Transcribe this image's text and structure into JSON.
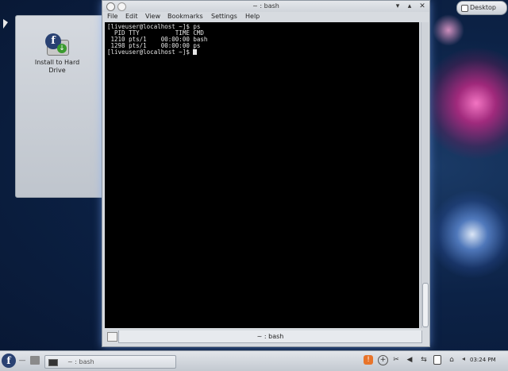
{
  "desktop": {
    "toolbox_label": "Desktop",
    "icons": [
      {
        "label_line1": "Install to Hard",
        "label_line2": "Drive",
        "icon": "fedora-install-icon"
      }
    ]
  },
  "window": {
    "title": "~ : bash",
    "menu": [
      "File",
      "Edit",
      "View",
      "Bookmarks",
      "Settings",
      "Help"
    ],
    "terminal_lines": [
      "[liveuser@localhost ~]$ ps",
      "  PID TTY          TIME CMD",
      " 1210 pts/1    00:00:00 bash",
      " 1298 pts/1    00:00:00 ps",
      "[liveuser@localhost ~]$ "
    ],
    "tab_label": "~ : bash"
  },
  "panel": {
    "task_label": "~ : bash",
    "clock": "03:24 PM",
    "launcher_glyph": "f"
  },
  "colors": {
    "terminal_bg": "#000000",
    "terminal_fg": "#e6e6e6",
    "panel_bg": "#d0d5dc",
    "fedora_blue": "#294172"
  }
}
